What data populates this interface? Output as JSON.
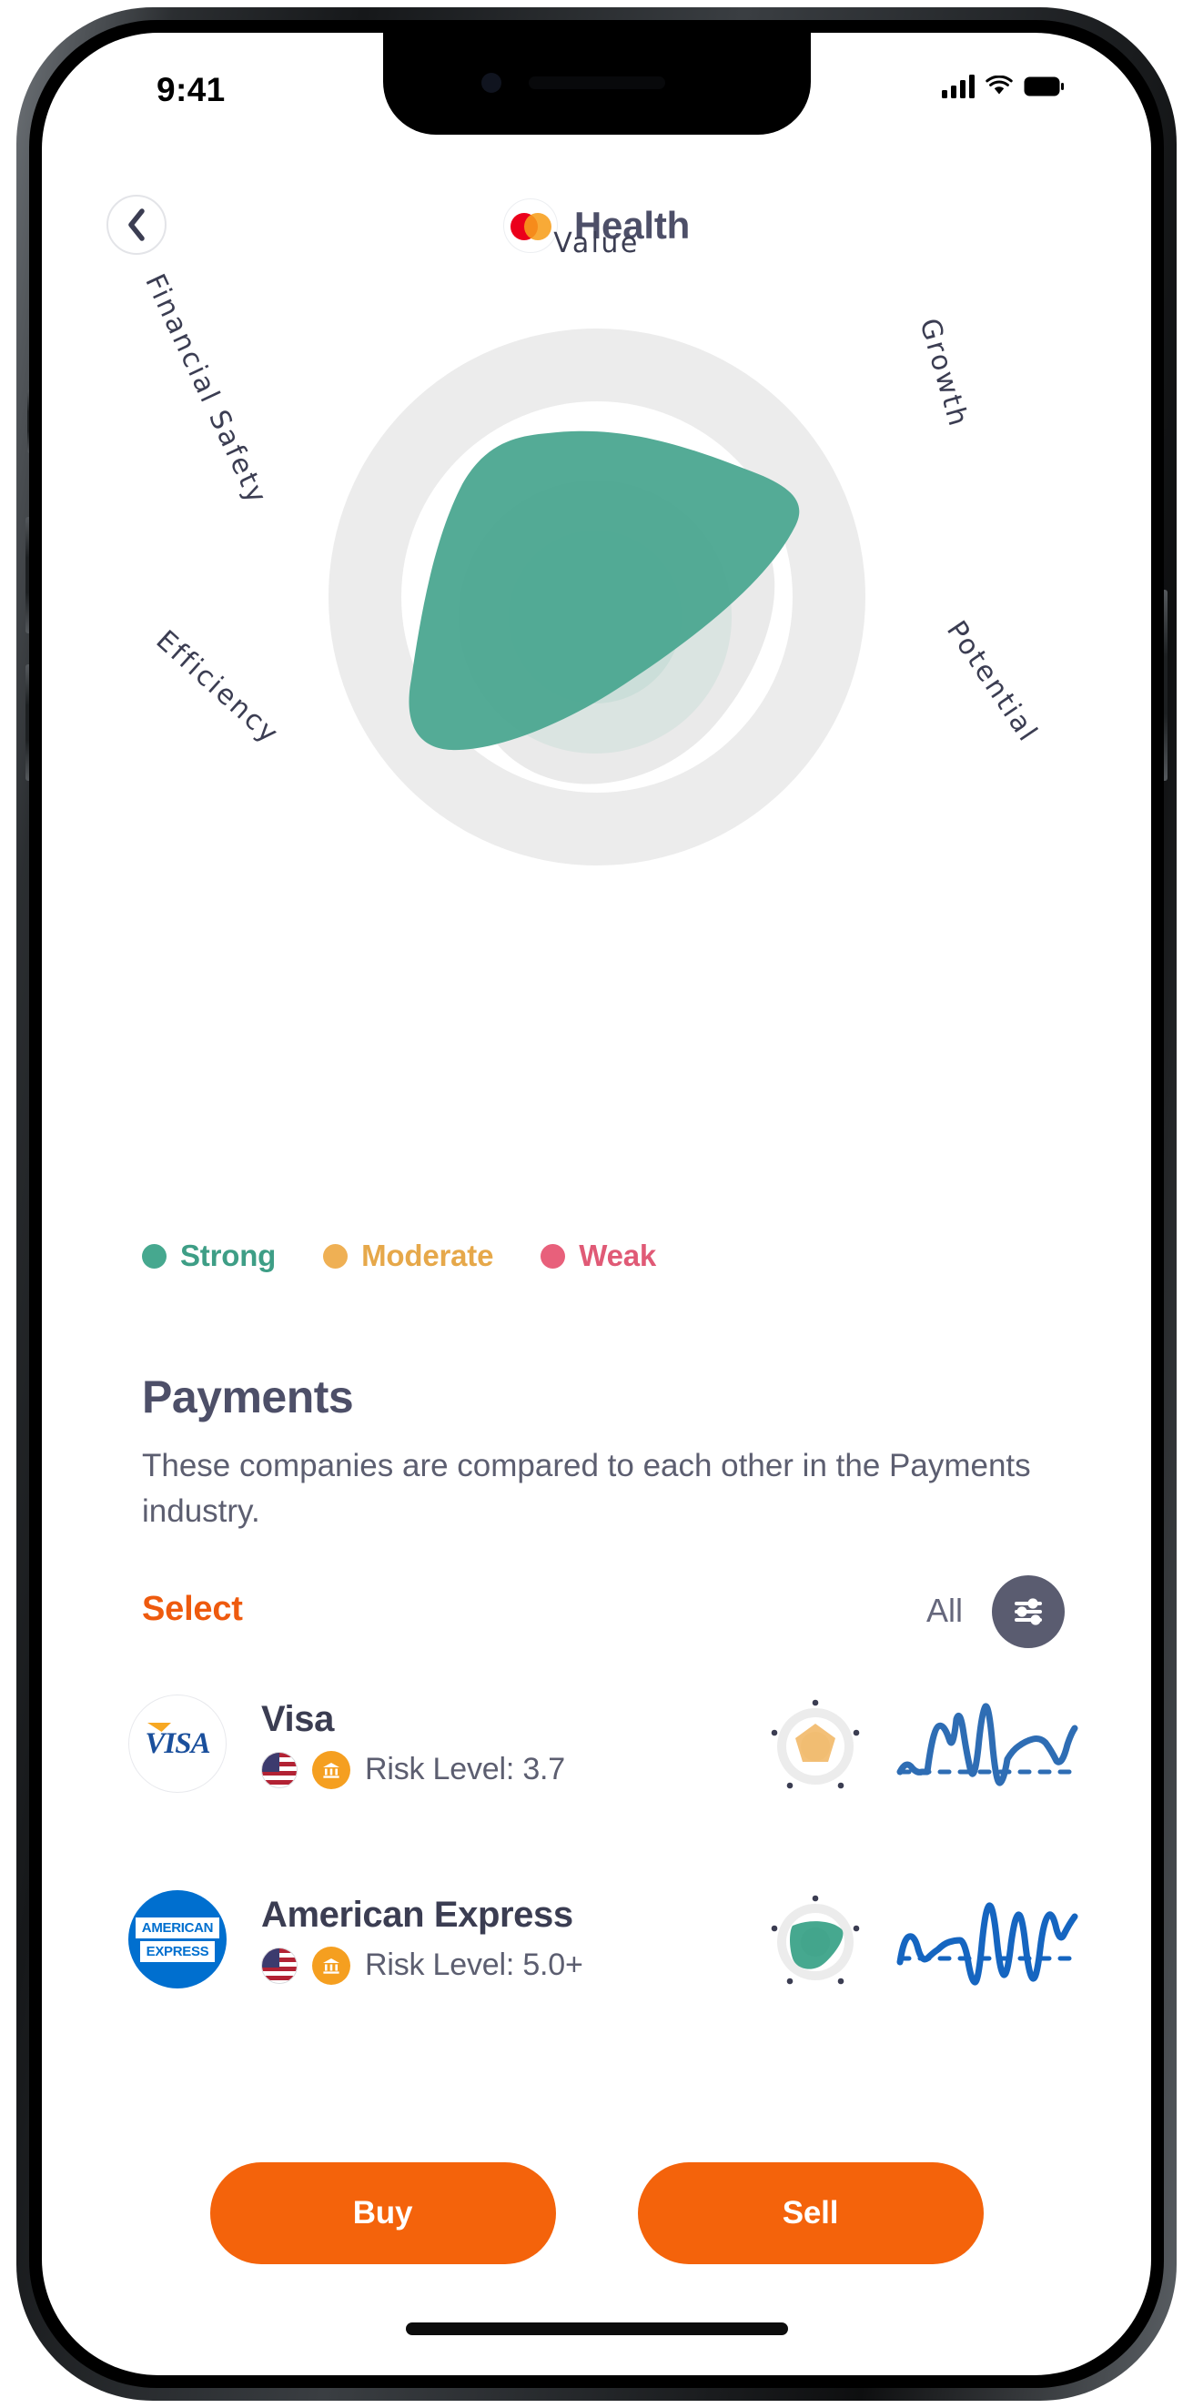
{
  "status_bar": {
    "time": "9:41",
    "signal_icon": "signal-bars-icon",
    "wifi_icon": "wifi-icon",
    "battery_icon": "battery-icon"
  },
  "header": {
    "back_icon": "chevron-left-icon",
    "brand_logo_icon": "mastercard-logo-icon",
    "title": "Health"
  },
  "chart_data": {
    "type": "radar",
    "title": "Health",
    "categories": [
      "Value",
      "Growth",
      "Potential",
      "Efficiency",
      "Financial Safety"
    ],
    "series": [
      {
        "name": "Mastercard",
        "values": [
          4.2,
          5.4,
          3.1,
          4.6,
          3.4
        ],
        "color": "#46A88F"
      }
    ],
    "axis_range": [
      0,
      6
    ],
    "grid": true,
    "legend_position": "below",
    "legend": [
      {
        "label": "Strong",
        "color": "#46A88F"
      },
      {
        "label": "Moderate",
        "color": "#EFB054"
      },
      {
        "label": "Weak",
        "color": "#E8607B"
      }
    ]
  },
  "legend": [
    {
      "label": "Strong",
      "color": "#46A88F"
    },
    {
      "label": "Moderate",
      "color": "#EFB054"
    },
    {
      "label": "Weak",
      "color": "#E8607B"
    }
  ],
  "payments": {
    "title": "Payments",
    "description": "These companies are compared to each other in the Payments industry.",
    "select_label": "Select",
    "all_label": "All",
    "filter_icon": "sliders-filter-icon",
    "companies": [
      {
        "name": "Visa",
        "logo_icon": "visa-logo-icon",
        "logo_text": "VISA",
        "country_icon": "us-flag-icon",
        "sector_icon": "bank-icon",
        "risk_label": "Risk Level: 3.7",
        "gauge_color": "#F3C078",
        "gauge_icon": "radar-mini-gauge-icon",
        "sparkline_icon": "sparkline-chart-icon",
        "sparkline_color": "#2E6DB4"
      },
      {
        "name": "American Express",
        "logo_icon": "amex-logo-icon",
        "logo_line_1": "AMERICAN",
        "logo_line_2": "EXPRESS",
        "country_icon": "us-flag-icon",
        "sector_icon": "bank-icon",
        "risk_label": "Risk Level: 5.0+",
        "gauge_color": "#46A88F",
        "gauge_icon": "radar-mini-gauge-icon",
        "sparkline_icon": "sparkline-chart-icon",
        "sparkline_color": "#1565C0"
      }
    ]
  },
  "actions": {
    "buy_label": "Buy",
    "sell_label": "Sell"
  },
  "colors": {
    "accent_orange": "#F4630B",
    "select_orange": "#EE5A0E",
    "title_navy": "#4d4f68",
    "strong_green": "#46A88F",
    "moderate_amber": "#EFB054",
    "weak_pink": "#E8607B"
  }
}
